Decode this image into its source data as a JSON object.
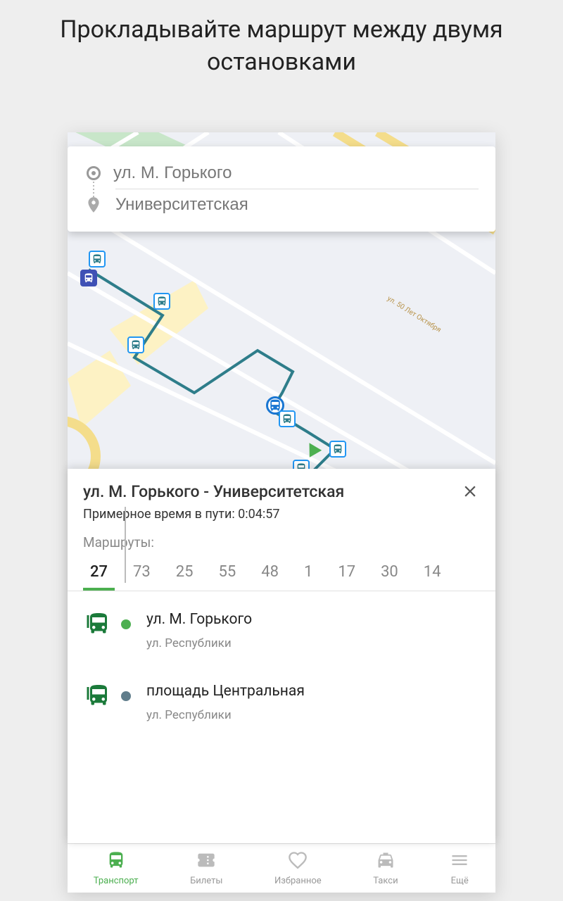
{
  "hero": {
    "title": "Прокладывайте маршрут между двумя остановками"
  },
  "search": {
    "origin": "ул. М. Горького",
    "destination": "Университетская"
  },
  "map": {
    "streetLabel": "ул. 50 Лет Октября"
  },
  "panel": {
    "title": "ул. М. Горького - Университетская",
    "travelTimeLabel": "Примерное время в пути:",
    "travelTime": "0:04:57",
    "routesLabel": "Маршруты:",
    "routes": [
      "27",
      "73",
      "25",
      "55",
      "48",
      "1",
      "17",
      "30",
      "14"
    ],
    "activeRoute": "27",
    "stops": [
      {
        "name": "ул. М. Горького",
        "street": "ул. Республики",
        "dotColor": "green"
      },
      {
        "name": "площадь Центральная",
        "street": "ул. Республики",
        "dotColor": "grey"
      }
    ]
  },
  "nav": {
    "items": [
      {
        "label": "Транспорт",
        "icon": "bus",
        "active": true
      },
      {
        "label": "Билеты",
        "icon": "ticket",
        "active": false
      },
      {
        "label": "Избранное",
        "icon": "heart",
        "active": false
      },
      {
        "label": "Такси",
        "icon": "taxi",
        "active": false
      },
      {
        "label": "Ещё",
        "icon": "menu",
        "active": false
      }
    ]
  },
  "colors": {
    "accent": "#4caf50",
    "routeLine": "#2e7d8a"
  }
}
